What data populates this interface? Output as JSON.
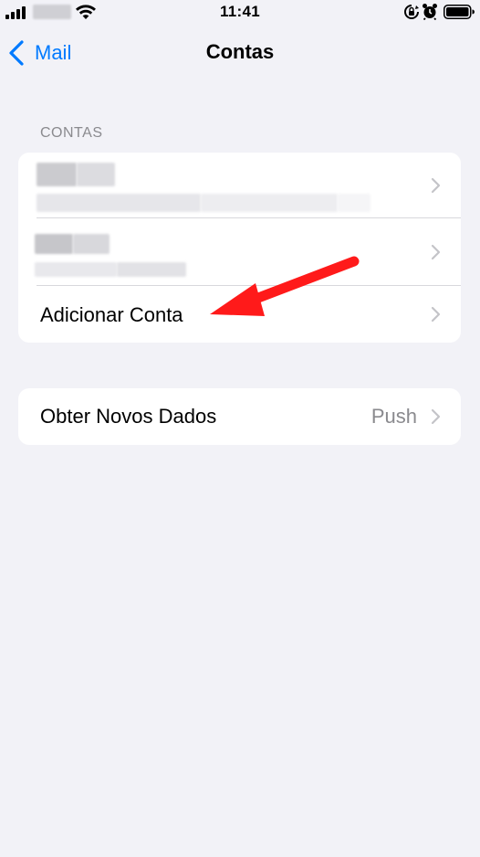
{
  "status_bar": {
    "time": "11:41",
    "signal_icon": "cellular-signal-icon",
    "wifi_icon": "wifi-icon",
    "rotation_lock_icon": "rotation-lock-icon",
    "alarm_icon": "alarm-clock-icon",
    "battery_icon": "battery-icon"
  },
  "nav": {
    "back_label": "Mail",
    "title": "Contas"
  },
  "accounts_section": {
    "header": "CONTAS",
    "add_account_label": "Adicionar Conta"
  },
  "fetch_section": {
    "label": "Obter Novos Dados",
    "value": "Push"
  },
  "colors": {
    "background": "#f2f2f7",
    "accent": "#007aff",
    "secondary_text": "#8a8a8e",
    "annotation_arrow": "#ff1a1a"
  }
}
